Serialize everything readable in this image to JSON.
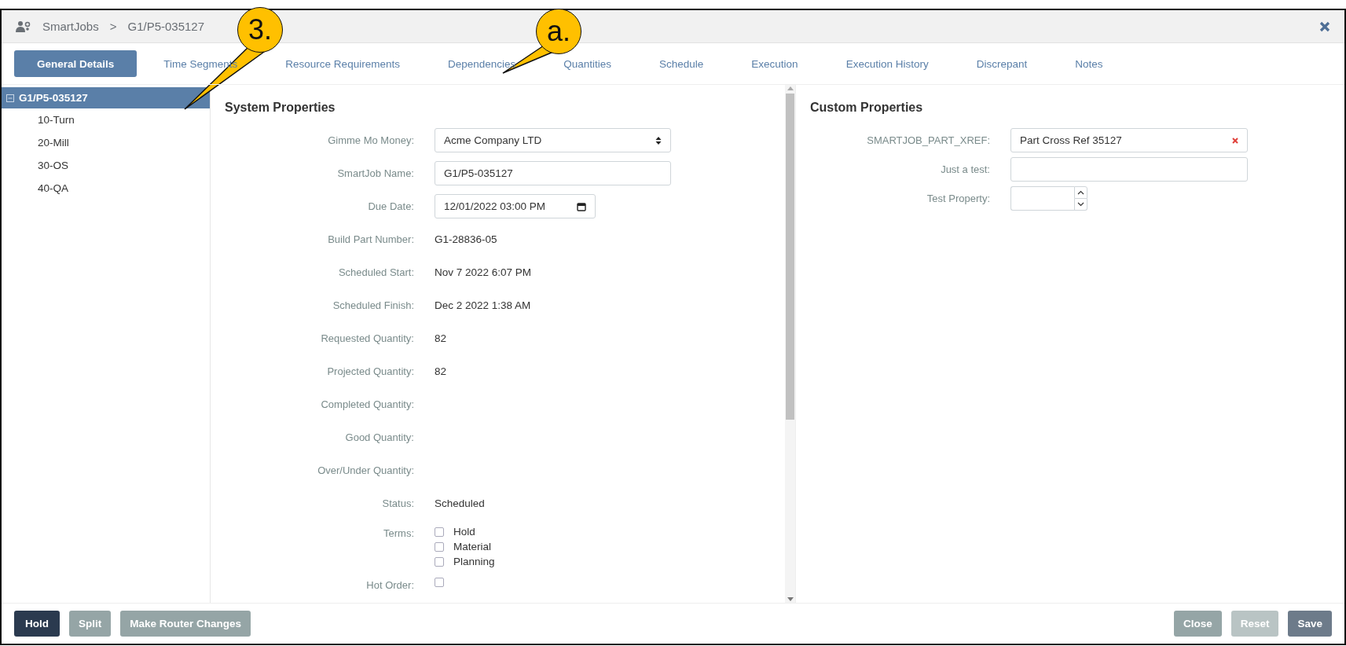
{
  "header": {
    "breadcrumb": [
      {
        "label": "SmartJobs"
      },
      {
        "label": "G1/P5-035127"
      }
    ],
    "separator": ">"
  },
  "tabs": [
    {
      "label": "General Details",
      "selected": true
    },
    {
      "label": "Time Segments",
      "selected": false
    },
    {
      "label": "Resource Requirements",
      "selected": false
    },
    {
      "label": "Dependencies",
      "selected": false
    },
    {
      "label": "Quantities",
      "selected": false
    },
    {
      "label": "Schedule",
      "selected": false
    },
    {
      "label": "Execution",
      "selected": false
    },
    {
      "label": "Execution History",
      "selected": false
    },
    {
      "label": "Discrepant",
      "selected": false
    },
    {
      "label": "Notes",
      "selected": false
    }
  ],
  "tree": {
    "label": "G1/P5-035127",
    "selected": true,
    "expanded": true,
    "children": [
      {
        "label": "10-Turn",
        "selected": false
      },
      {
        "label": "20-Mill",
        "selected": false
      },
      {
        "label": "30-OS",
        "selected": false
      },
      {
        "label": "40-QA",
        "selected": false
      }
    ]
  },
  "system_properties": {
    "title": "System Properties",
    "fields": [
      {
        "kind": "select",
        "label": "Gimme Mo Money:",
        "value": "Acme Company LTD"
      },
      {
        "kind": "input",
        "label": "SmartJob Name:",
        "value": "G1/P5-035127"
      },
      {
        "kind": "datetime",
        "label": "Due Date:",
        "value": "12/01/2022 03:00 PM"
      },
      {
        "kind": "text",
        "label": "Build Part Number:",
        "value": "G1-28836-05"
      },
      {
        "kind": "text",
        "label": "Scheduled Start:",
        "value": "Nov 7 2022 6:07 PM"
      },
      {
        "kind": "text",
        "label": "Scheduled Finish:",
        "value": "Dec 2 2022 1:38 AM"
      },
      {
        "kind": "text",
        "label": "Requested Quantity:",
        "value": "82"
      },
      {
        "kind": "text",
        "label": "Projected Quantity:",
        "value": "82"
      },
      {
        "kind": "text",
        "label": "Completed Quantity:"
      },
      {
        "kind": "text",
        "label": "Good Quantity:"
      },
      {
        "kind": "text",
        "label": "Over/Under Quantity:"
      },
      {
        "kind": "text",
        "label": "Status:",
        "value": "Scheduled"
      },
      {
        "kind": "checkboxes",
        "label": "Terms:",
        "options": [
          {
            "label": "Hold",
            "checked": false
          },
          {
            "label": "Material",
            "checked": false
          },
          {
            "label": "Planning",
            "checked": false
          }
        ]
      },
      {
        "kind": "checkbox",
        "label": "Hot Order:",
        "checked": false
      }
    ]
  },
  "custom_properties": {
    "title": "Custom Properties",
    "fields": [
      {
        "kind": "clearable",
        "label": "SMARTJOB_PART_XREF:",
        "value": "Part Cross Ref 35127"
      },
      {
        "kind": "input",
        "label": "Just a test:"
      },
      {
        "kind": "number",
        "label": "Test Property:"
      }
    ]
  },
  "footer": {
    "left_buttons": [
      {
        "label": "Hold",
        "kind": "dark",
        "disabled": false
      },
      {
        "label": "Split",
        "kind": "muted",
        "disabled": false
      },
      {
        "label": "Make Router Changes",
        "kind": "muted",
        "disabled": false
      }
    ],
    "right_buttons": [
      {
        "label": "Close",
        "kind": "muted",
        "disabled": false
      },
      {
        "label": "Reset",
        "kind": "muted",
        "disabled": true
      },
      {
        "label": "Save",
        "kind": "slate",
        "disabled": false
      }
    ]
  },
  "callouts": [
    {
      "label": "3."
    },
    {
      "label": "a."
    }
  ]
}
